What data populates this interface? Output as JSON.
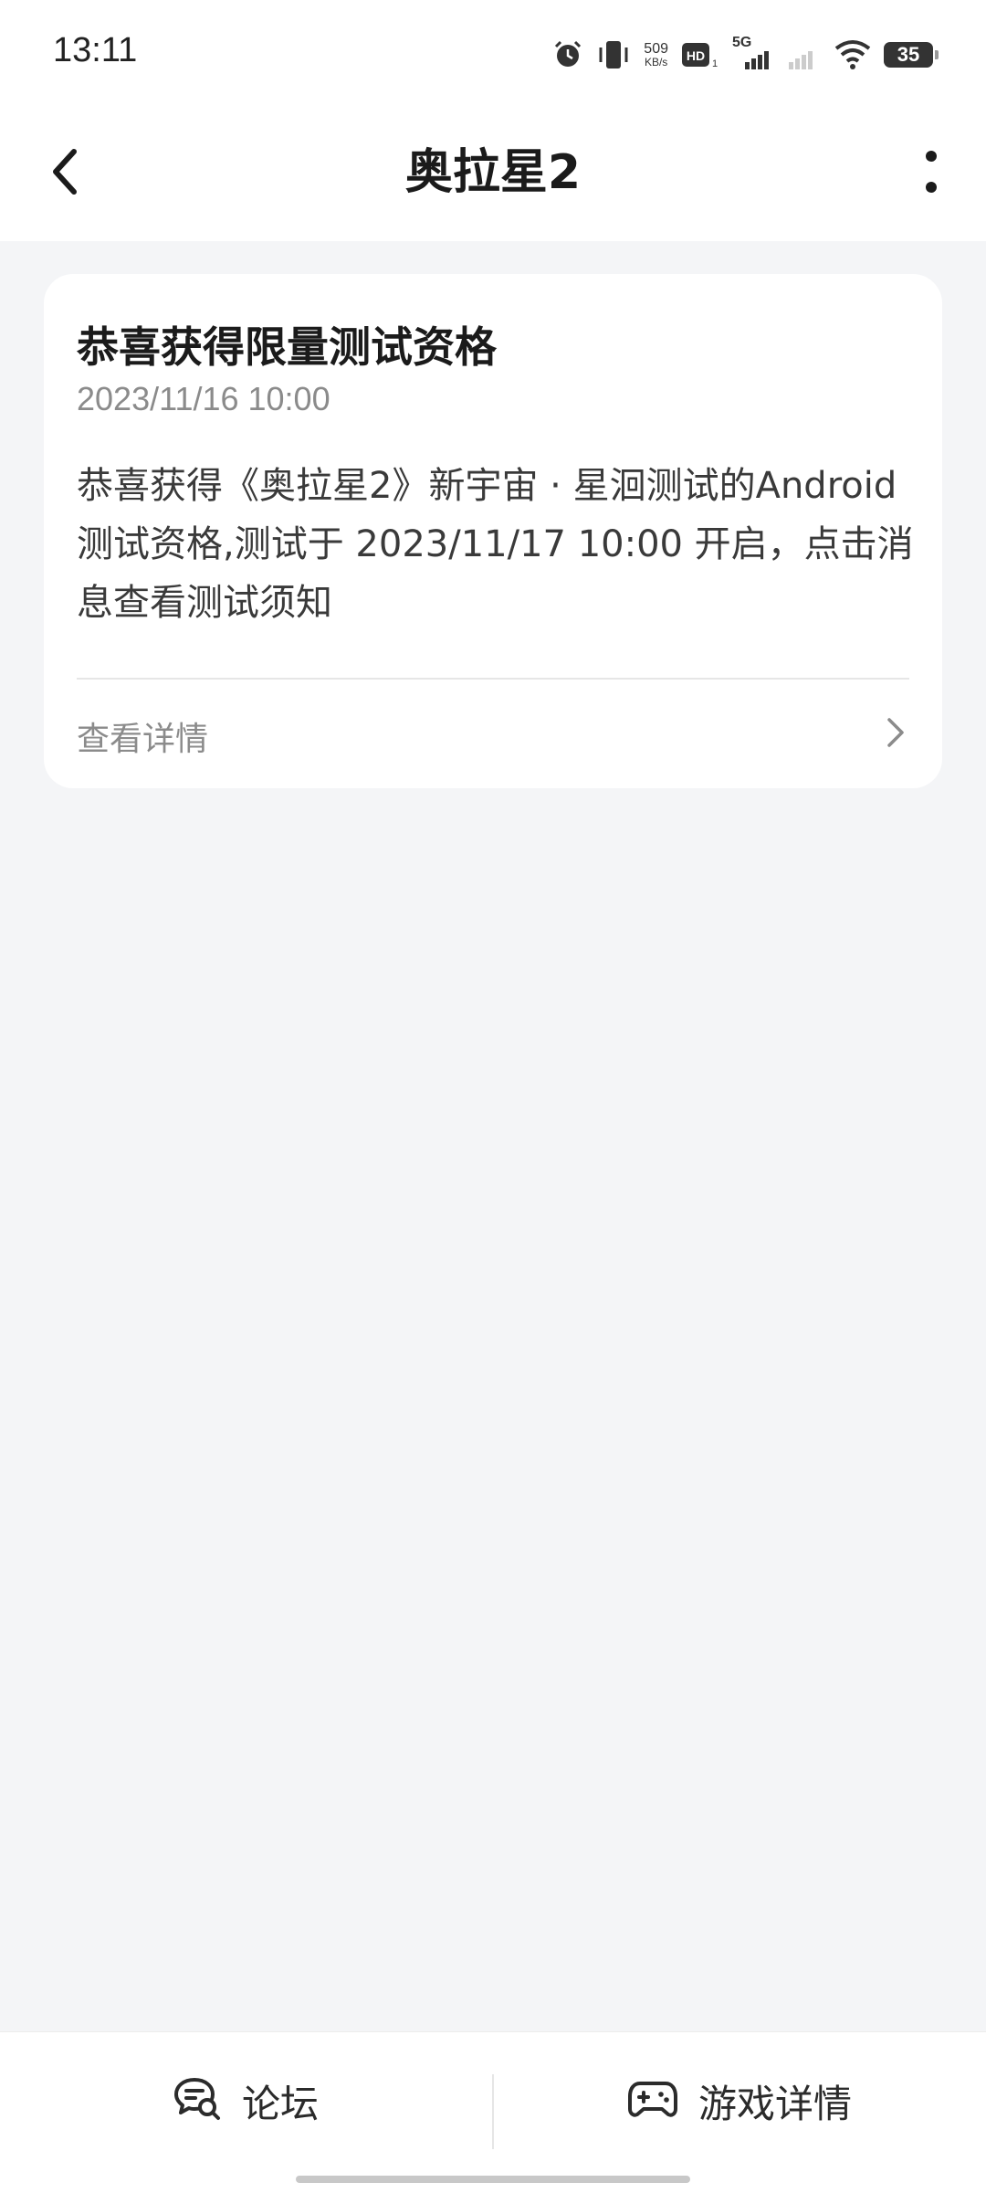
{
  "status_bar": {
    "time": "13:11",
    "net_speed_value": "509",
    "net_speed_unit": "KB/s",
    "network_label": "5G",
    "battery_level": "35",
    "icons": [
      "alarm-icon",
      "vibrate-icon",
      "hd-icon",
      "cellular-signal-icon",
      "cellular-signal-weak-icon",
      "wifi-icon",
      "battery-icon"
    ]
  },
  "header": {
    "title": "奥拉星2",
    "back_icon": "chevron-left-icon",
    "more_icon": "more-vertical-icon"
  },
  "message_card": {
    "title": "恭喜获得限量测试资格",
    "date": "2023/11/16 10:00",
    "body": "恭喜获得《奥拉星2》新宇宙 · 星洄测试的Android测试资格,测试于 2023/11/17 10:00 开启，点击消息查看测试须知",
    "link_label": "查看详情",
    "link_icon": "chevron-right-icon"
  },
  "bottom_bar": {
    "forum_label": "论坛",
    "forum_icon": "forum-chat-icon",
    "game_label": "游戏详情",
    "game_icon": "gamepad-icon"
  }
}
